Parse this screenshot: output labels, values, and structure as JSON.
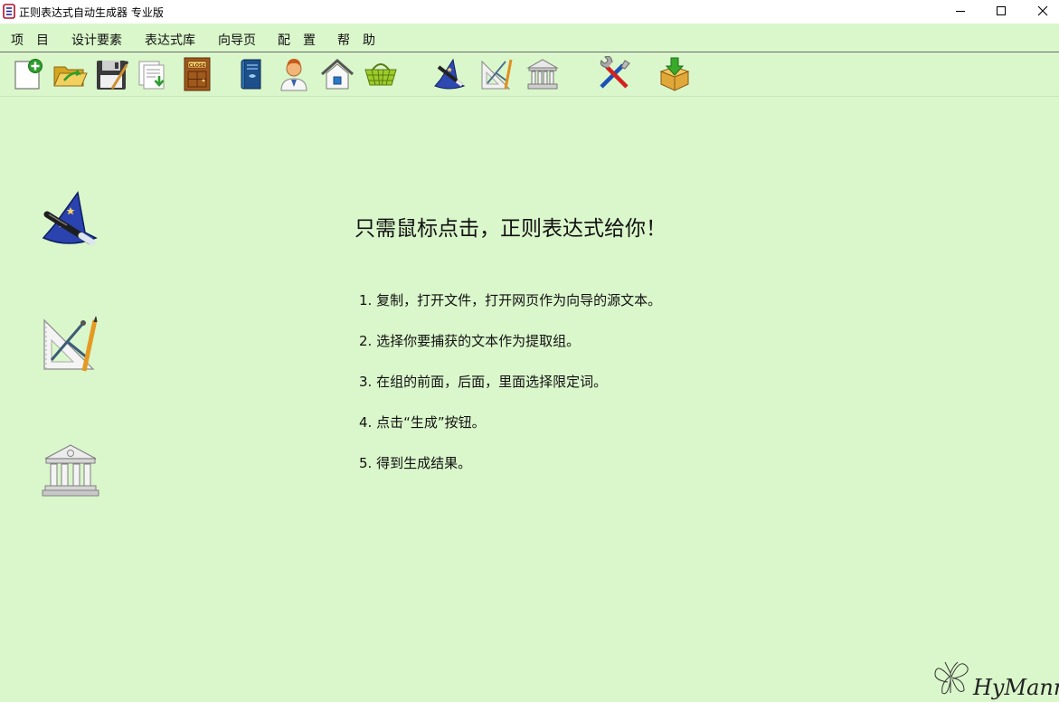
{
  "window": {
    "title": "正则表达式自动生成器 专业版"
  },
  "menu": {
    "items": [
      {
        "label": "项　目"
      },
      {
        "label": "设计要素"
      },
      {
        "label": "表达式库"
      },
      {
        "label": "向导页"
      },
      {
        "label": "配　置"
      },
      {
        "label": "帮　助"
      }
    ]
  },
  "toolbar": {
    "buttons": [
      {
        "icon": "new-file-icon"
      },
      {
        "icon": "open-folder-icon"
      },
      {
        "icon": "save-icon"
      },
      {
        "icon": "document-import-icon"
      },
      {
        "icon": "close-door-icon"
      },
      {
        "icon": "book-icon"
      },
      {
        "icon": "user-icon"
      },
      {
        "icon": "home-icon"
      },
      {
        "icon": "basket-icon"
      },
      {
        "icon": "wizard-icon"
      },
      {
        "icon": "design-tools-icon"
      },
      {
        "icon": "library-icon"
      },
      {
        "icon": "tools-icon"
      },
      {
        "icon": "download-box-icon"
      }
    ],
    "close_sign_text": "CLOSE"
  },
  "main": {
    "headline": "只需鼠标点击，正则表达式给你！",
    "steps": [
      "1. 复制，打开文件，打开网页作为向导的源文本。",
      "2. 选择你要捕获的文本作为提取组。",
      "3. 在组的前面，后面，里面选择限定词。",
      "4. 点击“生成”按钮。",
      "5. 得到生成结果。"
    ],
    "side_icons": [
      "wizard-icon",
      "design-tools-icon",
      "library-icon"
    ]
  },
  "signature": {
    "text": "HyMann"
  },
  "colors": {
    "background": "#daf6cb",
    "titlebar": "#ffffff"
  }
}
